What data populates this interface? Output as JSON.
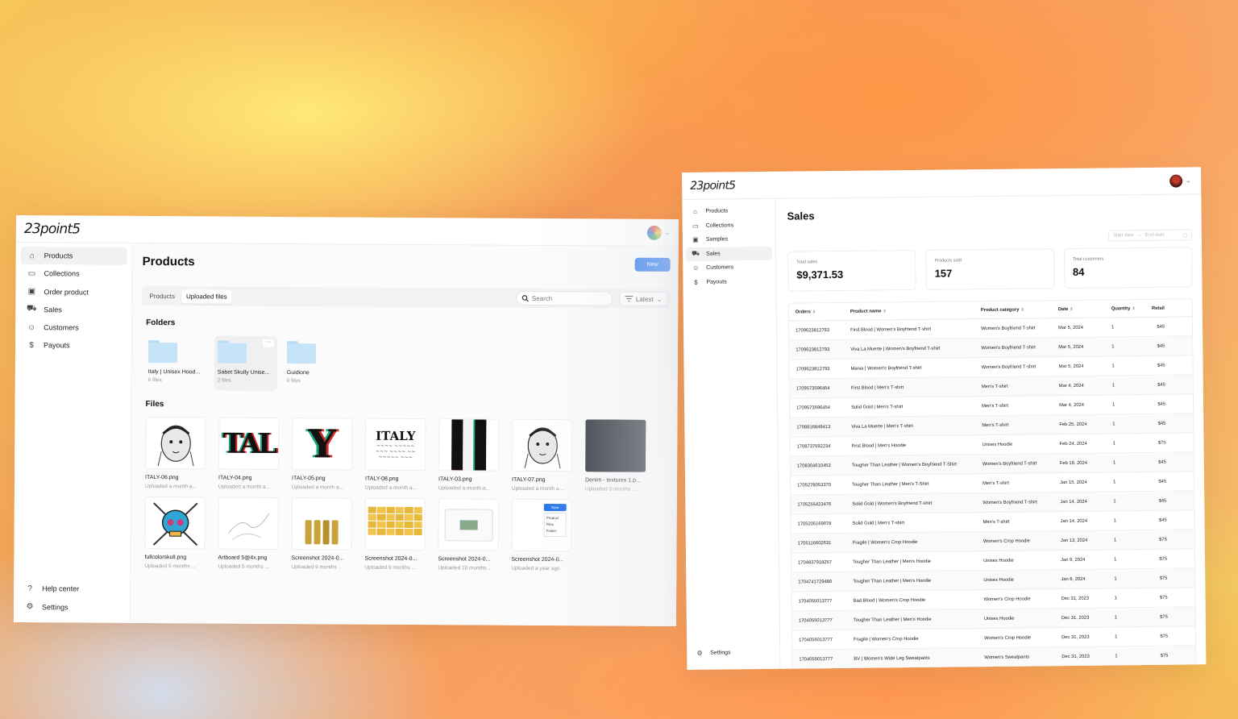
{
  "left": {
    "logo": "23point5",
    "avatar_caret": "⌄",
    "sidebar": [
      {
        "label": "Products",
        "icon": "tag-icon",
        "glyph": "⌂",
        "active": true
      },
      {
        "label": "Collections",
        "icon": "folder-icon",
        "glyph": "▭"
      },
      {
        "label": "Order product",
        "icon": "box-icon",
        "glyph": "▣"
      },
      {
        "label": "Sales",
        "icon": "cart-icon",
        "glyph": "⛟"
      },
      {
        "label": "Customers",
        "icon": "users-icon",
        "glyph": "☺"
      },
      {
        "label": "Payouts",
        "icon": "dollar-icon",
        "glyph": "$"
      }
    ],
    "sidebar_bottom": [
      {
        "label": "Help center",
        "icon": "help-icon",
        "glyph": "?"
      },
      {
        "label": "Settings",
        "icon": "gear-icon",
        "glyph": "⚙"
      }
    ],
    "title": "Products",
    "new_button": "New",
    "tabs": [
      "Products",
      "Uploaded files"
    ],
    "active_tab": "Uploaded files",
    "search_placeholder": "Search",
    "sort_label": "Latest",
    "folders_title": "Folders",
    "folders": [
      {
        "name": "Italy | Unisex Hood...",
        "count": "6 files"
      },
      {
        "name": "Sabet Skully Unise...",
        "count": "2 files",
        "more": "···"
      },
      {
        "name": "Guidione",
        "count": "0 files"
      }
    ],
    "files_title": "Files",
    "files": [
      {
        "name": "ITALY-06.png",
        "meta": "Uploaded a month a...",
        "thumb": "statue"
      },
      {
        "name": "ITALY-04.png",
        "meta": "Uploaded a month a...",
        "thumb": "TAL"
      },
      {
        "name": "ITALY-05.png",
        "meta": "Uploaded a month a...",
        "thumb": "Y"
      },
      {
        "name": "ITALY-08.png",
        "meta": "Uploaded a month a...",
        "thumb": "ITALY"
      },
      {
        "name": "ITALY-03.png",
        "meta": "Uploaded a month a...",
        "thumb": "stripes"
      },
      {
        "name": "ITALY-07.png",
        "meta": "Uploaded a month a...",
        "thumb": "statue"
      },
      {
        "name": "Denim - textures 1.p...",
        "meta": "Uploaded 3 months ...",
        "thumb": "dark"
      },
      {
        "name": "fullcolorskull.png",
        "meta": "Uploaded 5 months ...",
        "thumb": "skull"
      },
      {
        "name": "Artboard 5@4x.png",
        "meta": "Uploaded 5 months ...",
        "thumb": "sketch"
      },
      {
        "name": "Screenshot 2024-0...",
        "meta": "Uploaded 9 months ...",
        "thumb": "products"
      },
      {
        "name": "Screenshot 2024-0...",
        "meta": "Uploaded 9 months ...",
        "thumb": "yellow"
      },
      {
        "name": "Screenshot 2024-0...",
        "meta": "Uploaded 10 months...",
        "thumb": "modal"
      },
      {
        "name": "Screenshot 2024-0...",
        "meta": "Uploaded a year ago",
        "thumb": "menu",
        "menu": [
          "New",
          "Product",
          "Files",
          "Folder"
        ]
      }
    ],
    "thumb_text": {
      "TAL": "TAL",
      "Y": "Y",
      "ITALY": "ITALY"
    }
  },
  "right": {
    "logo": "23point5",
    "sidebar": [
      {
        "label": "Products",
        "glyph": "⌂"
      },
      {
        "label": "Collections",
        "glyph": "▭"
      },
      {
        "label": "Samples",
        "glyph": "▣"
      },
      {
        "label": "Sales",
        "glyph": "⛟",
        "active": true
      },
      {
        "label": "Customers",
        "glyph": "☺"
      },
      {
        "label": "Payouts",
        "glyph": "$"
      }
    ],
    "settings": "Settings",
    "title": "Sales",
    "start_date": "Start date",
    "end_date": "End date",
    "stats": [
      {
        "label": "Total sales",
        "value": "$9,371.53"
      },
      {
        "label": "Products sold",
        "value": "157"
      },
      {
        "label": "Total customers",
        "value": "84"
      }
    ],
    "columns": [
      "Orders",
      "Product name",
      "Product category",
      "Date",
      "Quantity",
      "Retail"
    ],
    "rows": [
      [
        "1709623812793",
        "First Blood | Women's Boyfriend T-shirt",
        "Women's Boyfriend T-shirt",
        "Mar 5, 2024",
        "1",
        "$45"
      ],
      [
        "1709623812793",
        "Viva La Muerte | Women's Boyfriend T-shirt",
        "Women's Boyfriend T-shirt",
        "Mar 5, 2024",
        "1",
        "$45"
      ],
      [
        "1709623812793",
        "Mania | Women's Boyfriend T-shirt",
        "Women's Boyfriend T-shirt",
        "Mar 5, 2024",
        "1",
        "$45"
      ],
      [
        "1709573596454",
        "First Blood | Men's T-shirt",
        "Men's T-shirt",
        "Mar 4, 2024",
        "1",
        "$45"
      ],
      [
        "1709573596454",
        "Solid Gold | Men's T-shirt",
        "Men's T-shirt",
        "Mar 4, 2024",
        "1",
        "$45"
      ],
      [
        "1708816849413",
        "Viva La Muerte | Men's T-shirt",
        "Men's T-shirt",
        "Feb 25, 2024",
        "1",
        "$45"
      ],
      [
        "1708737592234",
        "First Blood | Men's Hoodie",
        "Unisex Hoodie",
        "Feb 24, 2024",
        "1",
        "$75"
      ],
      [
        "1708304610453",
        "Tougher Than Leather | Women's Boyfriend T-Shirt",
        "Women's Boyfriend T-shirt",
        "Feb 19, 2024",
        "1",
        "$45"
      ],
      [
        "1705278053370",
        "Tougher Than Leather | Men's T-Shirt",
        "Men's T-shirt",
        "Jan 15, 2024",
        "1",
        "$45"
      ],
      [
        "1705255423476",
        "Solid Gold | Women's Boyfriend T-shirt",
        "Women's Boyfriend T-shirt",
        "Jan 14, 2024",
        "1",
        "$45"
      ],
      [
        "1705205169078",
        "Solid Gold | Men's T-shirt",
        "Men's T-shirt",
        "Jan 14, 2024",
        "1",
        "$45"
      ],
      [
        "1705116602631",
        "Fragile | Women's Crop Hoodie",
        "Women's Crop Hoodie",
        "Jan 13, 2024",
        "1",
        "$75"
      ],
      [
        "1704837918257",
        "Tougher Than Leather | Men's Hoodie",
        "Unisex Hoodie",
        "Jan 9, 2024",
        "1",
        "$75"
      ],
      [
        "1704741729480",
        "Tougher Than Leather | Men's Hoodie",
        "Unisex Hoodie",
        "Jan 8, 2024",
        "1",
        "$75"
      ],
      [
        "1704055013777",
        "Bad Blood | Women's Crop Hoodie",
        "Women's Crop Hoodie",
        "Dec 31, 2023",
        "1",
        "$75"
      ],
      [
        "1704055013777",
        "Tougher Than Leather | Men's Hoodie",
        "Unisex Hoodie",
        "Dec 31, 2023",
        "1",
        "$75"
      ],
      [
        "1704055013777",
        "Fragile | Women's Crop Hoodie",
        "Women's Crop Hoodie",
        "Dec 31, 2023",
        "1",
        "$75"
      ],
      [
        "1704055013777",
        "BV | Women's Wide Leg Sweatpants",
        "Women's Sweatpants",
        "Dec 31, 2023",
        "1",
        "$75"
      ]
    ]
  },
  "colors": {
    "accent": "#1f6feb",
    "folder": "#c6e3f8"
  }
}
